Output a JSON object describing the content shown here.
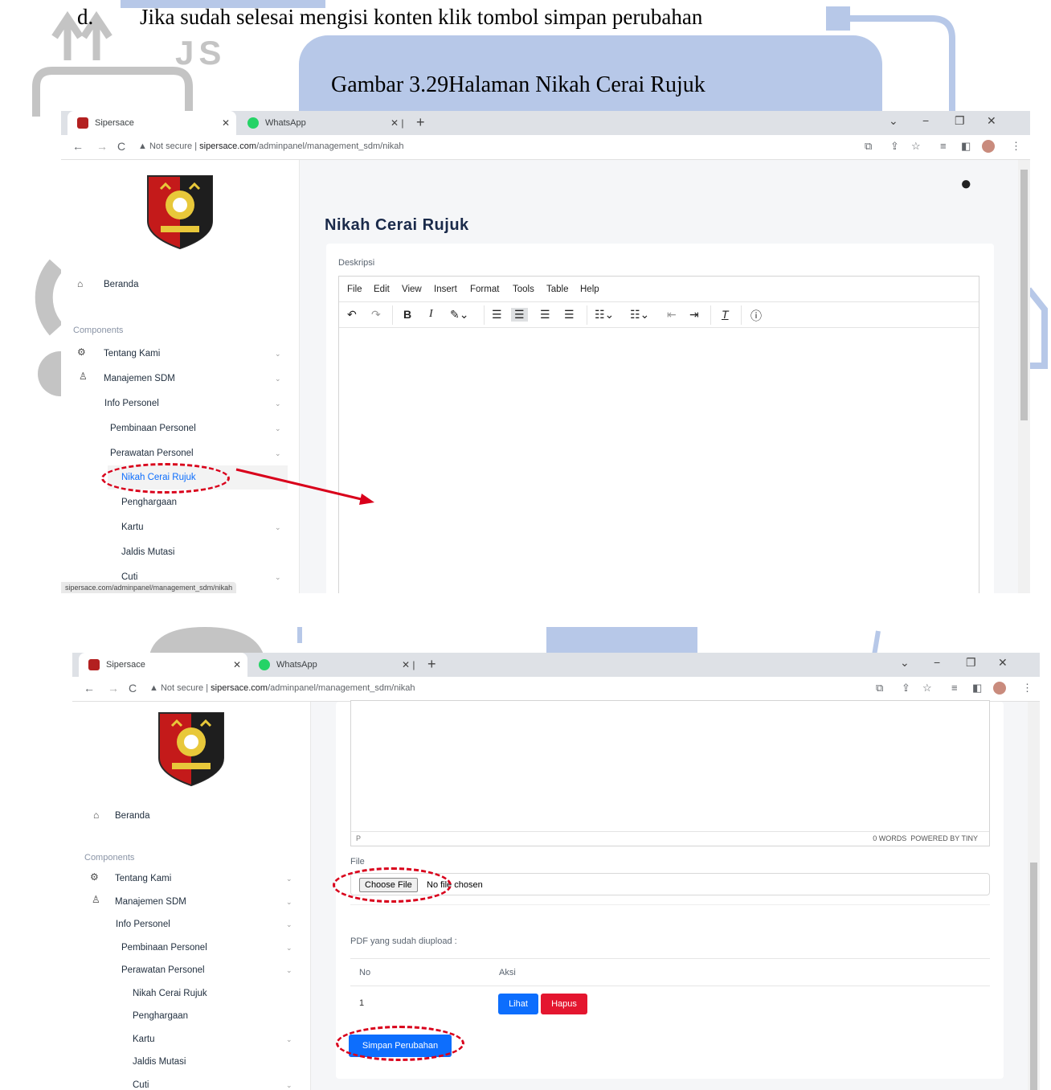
{
  "document": {
    "step_marker": "d.",
    "step_text": "Jika sudah selesai mengisi konten klik tombol simpan perubahan",
    "caption": "Gambar 3.29Halaman Nikah Cerai Rujuk",
    "watermark_letters": "JS"
  },
  "browser": {
    "tabs": [
      "Sipersace",
      "WhatsApp"
    ],
    "security_label": "Not secure",
    "url_host": "sipersace.com",
    "url_path": "/adminpanel/management_sdm/nikah",
    "status_link": "sipersace.com/adminpanel/management_sdm/nikah"
  },
  "sidebar": {
    "home": "Beranda",
    "section": "Components",
    "items": [
      "Tentang Kami",
      "Manajemen SDM",
      "Info Personel",
      "Pembinaan Personel",
      "Perawatan Personel",
      "Nikah Cerai Rujuk",
      "Penghargaan",
      "Kartu",
      "Jaldis Mutasi",
      "Cuti"
    ]
  },
  "page": {
    "title": "Nikah Cerai Rujuk",
    "desc_label": "Deskripsi",
    "editor_menu": [
      "File",
      "Edit",
      "View",
      "Insert",
      "Format",
      "Tools",
      "Table",
      "Help"
    ],
    "editor_path": "P",
    "editor_status": "0 WORDS  POWERED BY TINY",
    "file_label": "File",
    "choose_file": "Choose File",
    "no_file": "No file chosen",
    "uploaded_label": "PDF yang sudah diupload :",
    "table_headers": [
      "No",
      "Aksi"
    ],
    "table_rows": [
      {
        "no": "1",
        "lihat": "Lihat",
        "hapus": "Hapus"
      }
    ],
    "save_button": "Simpan Perubahan"
  },
  "colors": {
    "accent_blue": "#0d6efd",
    "danger_red": "#e4162f",
    "annotation_red": "#d9001b",
    "caption_bg": "#b7c8e8"
  }
}
